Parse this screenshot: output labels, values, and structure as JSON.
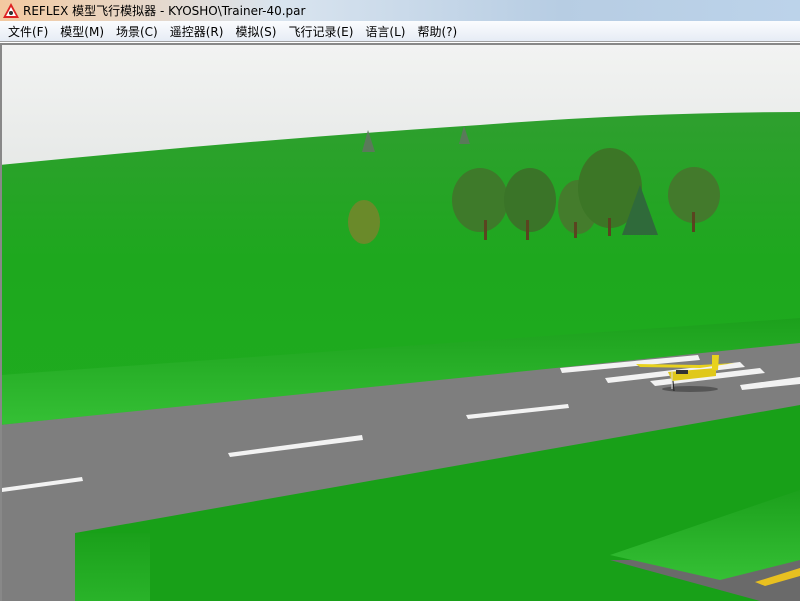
{
  "window": {
    "title": "REFLEX 模型飞行模拟器 - KYOSHO\\Trainer-40.par",
    "icon": "reflex-logo-icon"
  },
  "menu": [
    {
      "label": "文件(F)"
    },
    {
      "label": "模型(M)"
    },
    {
      "label": "场景(C)"
    },
    {
      "label": "遥控器(R)"
    },
    {
      "label": "模拟(S)"
    },
    {
      "label": "飞行记录(E)"
    },
    {
      "label": "语言(L)"
    },
    {
      "label": "帮助(?)"
    }
  ],
  "colors": {
    "sky": "#eceeed",
    "grass": "#1fae1f",
    "runway": "#7f7f7f",
    "plane": "#e8d21e"
  }
}
